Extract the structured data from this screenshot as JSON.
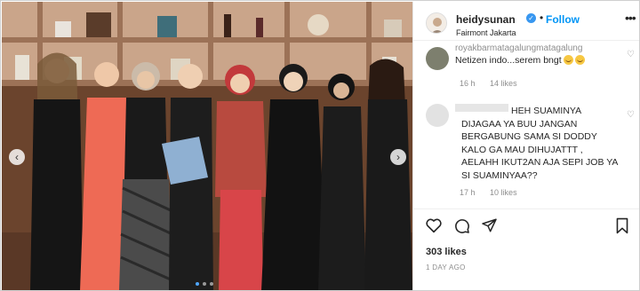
{
  "post": {
    "username": "heidysunan",
    "separator": "•",
    "follow_label": "Follow",
    "location": "Fairmont Jakarta",
    "more_icon": "more-horizontal-icon",
    "likes_text": "303 likes",
    "date_text": "1 DAY AGO"
  },
  "photo": {
    "prev_arrow": "‹",
    "next_arrow": "›",
    "carousel_dots": 3,
    "active_dot": 0
  },
  "comments": [
    {
      "user": "royakbarmatagalungmatagalung",
      "text": "Netizen indo...serem bngt",
      "emojis": 2,
      "age": "16 h",
      "likes": "14 likes"
    },
    {
      "user": "",
      "text": "HEH SUAMINYA DIJAGAA YA BUU JANGAN BERGABUNG SAMA SI DODDY KALO GA MAU DIHUJATTT , AELAHH IKUT2AN AJA SEPI JOB YA SI SUAMINYAA??",
      "age": "17 h",
      "likes": "10 likes"
    }
  ],
  "colors": {
    "accent": "#0095f6",
    "verified": "#3897f0",
    "muted": "#8e8e8e",
    "text": "#262626"
  }
}
